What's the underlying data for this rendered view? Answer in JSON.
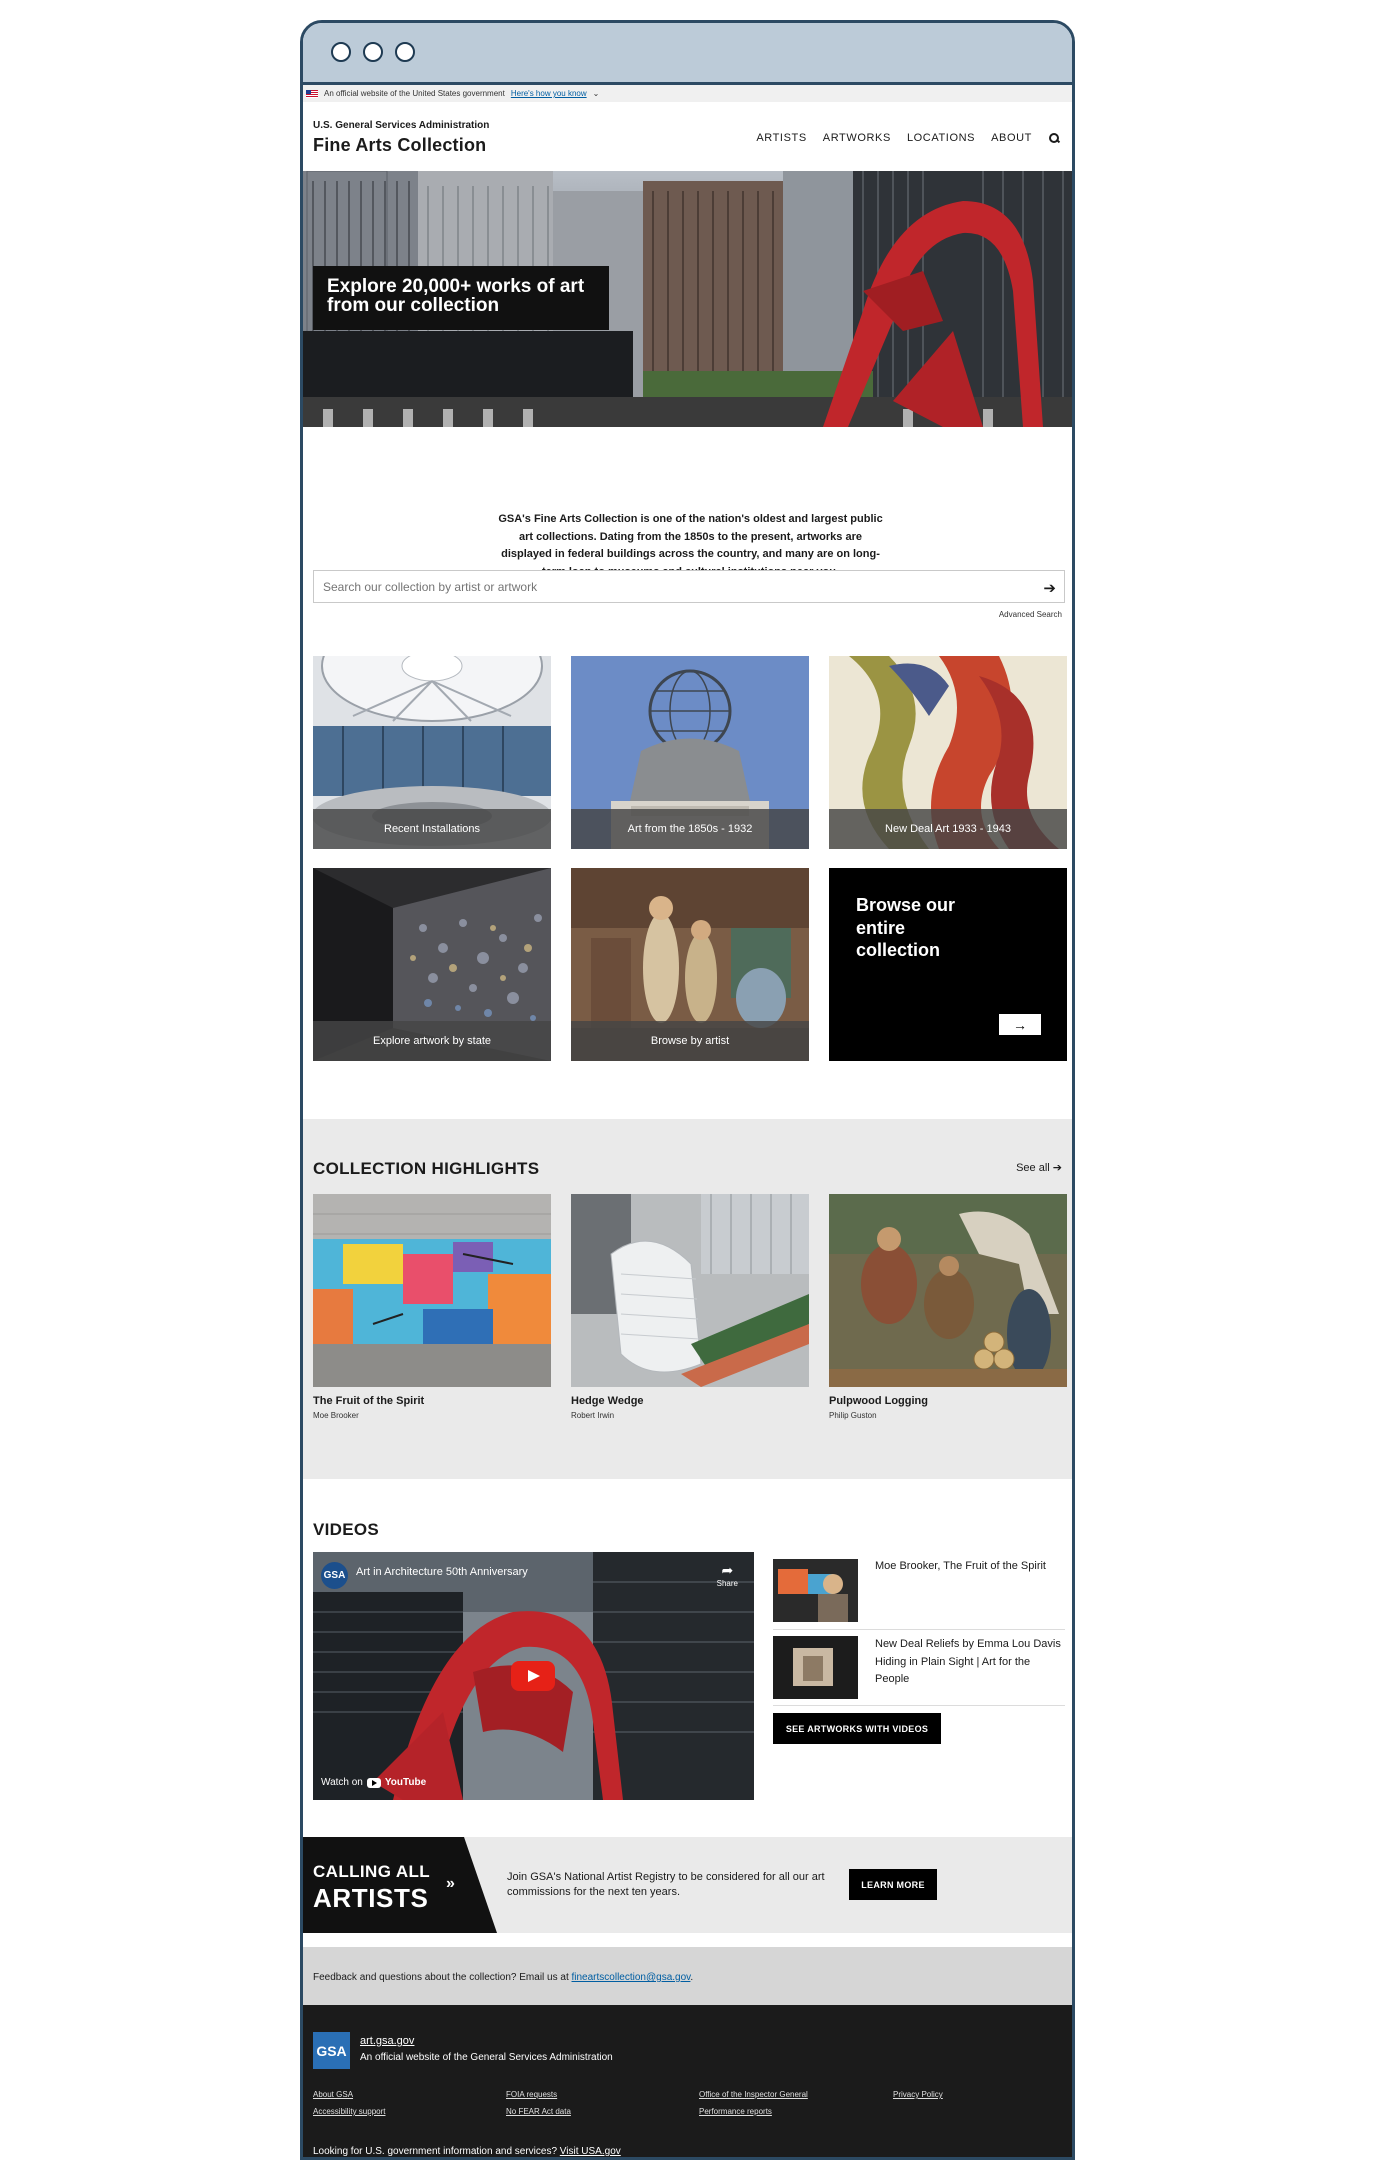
{
  "gov_banner": {
    "text": "An official website of the United States government",
    "link": "Here's how you know"
  },
  "header": {
    "agency": "U.S. General Services Administration",
    "title": "Fine Arts Collection",
    "nav": [
      "ARTISTS",
      "ARTWORKS",
      "LOCATIONS",
      "ABOUT"
    ],
    "search_icon": "search-icon"
  },
  "hero": {
    "heading": "Explore 20,000+ works of art from our collection"
  },
  "intro": "GSA's Fine Arts Collection is one of the nation's oldest and largest public art collections. Dating from the 1850s to the present, artworks are displayed in federal buildings across the country, and many are on long-term loan to museums and cultural institutions near you.",
  "search": {
    "placeholder": "Search our collection by artist or artwork",
    "advanced": "Advanced Search"
  },
  "tiles": [
    {
      "label": "Recent Installations"
    },
    {
      "label": "Art from the 1850s - 1932"
    },
    {
      "label": "New Deal Art 1933 - 1943"
    },
    {
      "label": "Explore artwork by state"
    },
    {
      "label": "Browse by artist"
    }
  ],
  "browse": {
    "text": "Browse our entire collection",
    "arrow_icon": "arrow-right-icon"
  },
  "highlights": {
    "title": "COLLECTION HIGHLIGHTS",
    "see_all": "See all",
    "items": [
      {
        "title": "The Fruit of the Spirit",
        "artist": "Moe Brooker"
      },
      {
        "title": "Hedge Wedge",
        "artist": "Robert Irwin"
      },
      {
        "title": "Pulpwood Logging",
        "artist": "Philip Guston"
      }
    ]
  },
  "videos": {
    "title": "VIDEOS",
    "main": {
      "channel": "GSA",
      "title": "Art in Architecture 50th Anniversary",
      "share": "Share",
      "watch_on": "Watch on",
      "youtube": "YouTube"
    },
    "list": [
      {
        "title": "Moe Brooker, The Fruit of the Spirit"
      },
      {
        "title": "New Deal Reliefs by Emma Lou Davis Hiding in Plain Sight | Art for the People"
      }
    ],
    "button": "SEE ARTWORKS WITH VIDEOS"
  },
  "calling": {
    "line1": "CALLING ALL",
    "line2": "ARTISTS",
    "text": "Join GSA's National Artist Registry to be considered for all our art commissions for the next ten years.",
    "button": "LEARN MORE"
  },
  "feedback": {
    "text": "Feedback and questions about the collection?  Email us at ",
    "email": "fineartscollection@gsa.gov",
    "end": "."
  },
  "footer": {
    "logo": "GSA",
    "url": "art.gsa.gov",
    "official": "An official website of the General Services Administration",
    "links": [
      [
        "About GSA",
        "Accessibility support"
      ],
      [
        "FOIA requests",
        "No FEAR Act data"
      ],
      [
        "Office of the Inspector General",
        "Performance reports"
      ],
      [
        "Privacy Policy"
      ]
    ],
    "bottom_text": "Looking for U.S. government information and services? ",
    "bottom_link": "Visit USA.gov"
  },
  "colors": {
    "accent_blue": "#005ea2",
    "frame": "#2c4a63",
    "chrome": "#bccbd8",
    "calder_red": "#c0262b"
  }
}
